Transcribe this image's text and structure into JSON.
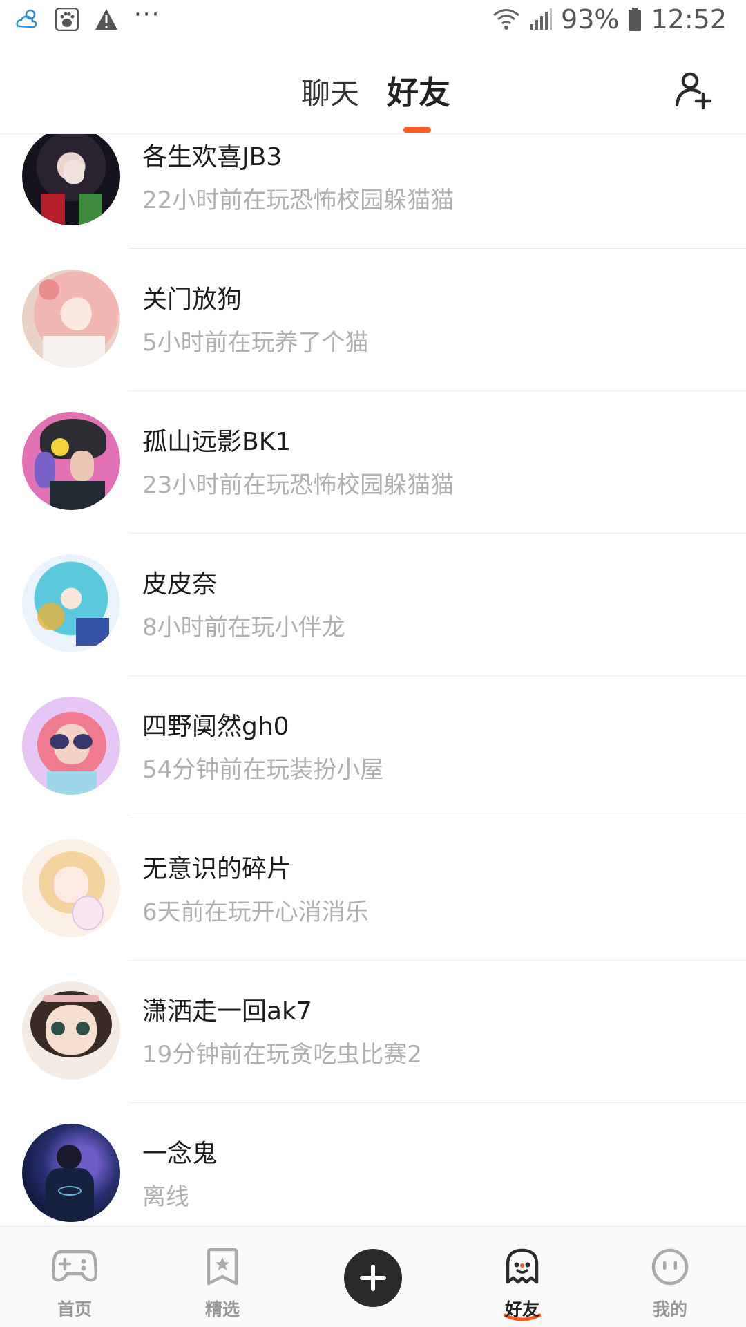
{
  "status_bar": {
    "battery": "93%",
    "time": "12:52",
    "more": "···"
  },
  "header": {
    "tabs": [
      {
        "label": "聊天",
        "active": false
      },
      {
        "label": "好友",
        "active": true
      }
    ],
    "accent_color": "#ff5a1f"
  },
  "friends": [
    {
      "name": "各生欢喜JB3",
      "status": "22小时前在玩恐怖校园躲猫猫"
    },
    {
      "name": "关门放狗",
      "status": "5小时前在玩养了个猫"
    },
    {
      "name": "孤山远影BK1",
      "status": "23小时前在玩恐怖校园躲猫猫"
    },
    {
      "name": "皮皮奈",
      "status": "8小时前在玩小伴龙"
    },
    {
      "name": "四野阒然gh0",
      "status": "54分钟前在玩装扮小屋"
    },
    {
      "name": "无意识的碎片",
      "status": "6天前在玩开心消消乐"
    },
    {
      "name": "潇洒走一回ak7",
      "status": "19分钟前在玩贪吃虫比赛2"
    },
    {
      "name": "一念鬼",
      "status": "离线"
    }
  ],
  "bottom_nav": {
    "items": [
      {
        "label": "首页",
        "icon": "gamepad-icon",
        "active": false
      },
      {
        "label": "精选",
        "icon": "star-bookmark-icon",
        "active": false
      },
      {
        "label": "",
        "icon": "plus-icon",
        "active": false
      },
      {
        "label": "好友",
        "icon": "ghost-icon",
        "active": true
      },
      {
        "label": "我的",
        "icon": "face-icon",
        "active": false
      }
    ]
  }
}
